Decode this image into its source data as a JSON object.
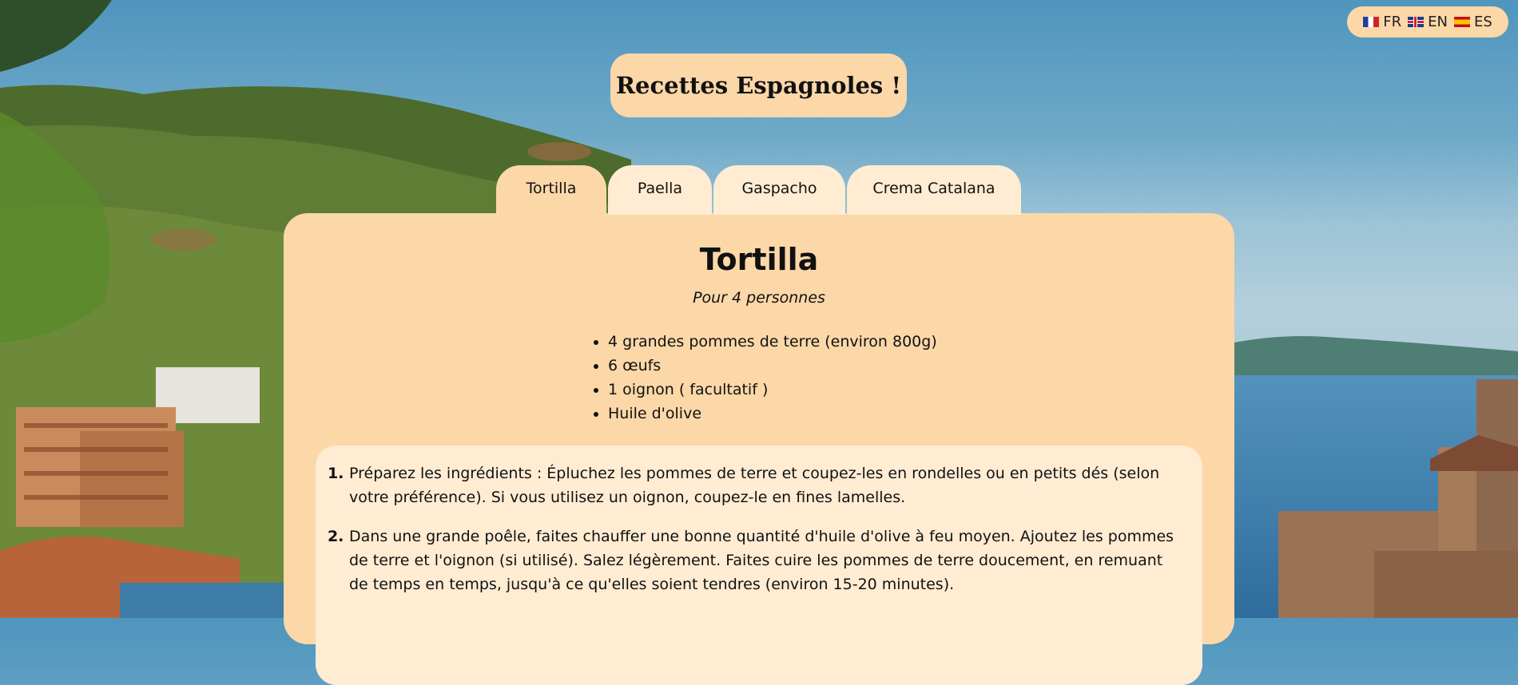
{
  "languages": [
    {
      "code": "FR",
      "flag_icon": "flag-fr-icon"
    },
    {
      "code": "EN",
      "flag_icon": "flag-uk-icon"
    },
    {
      "code": "ES",
      "flag_icon": "flag-es-icon"
    }
  ],
  "site": {
    "title": "Recettes Espagnoles !"
  },
  "tabs": [
    {
      "label": "Tortilla",
      "active": true
    },
    {
      "label": "Paella",
      "active": false
    },
    {
      "label": "Gaspacho",
      "active": false
    },
    {
      "label": "Crema Catalana",
      "active": false
    }
  ],
  "recipe": {
    "title": "Tortilla",
    "servings": "Pour 4 personnes",
    "ingredients": [
      "4 grandes pommes de terre (environ 800g)",
      "6 œufs",
      "1 oignon ( facultatif )",
      "Huile d'olive"
    ],
    "steps": [
      "Préparez les ingrédients : Épluchez les pommes de terre et coupez-les en rondelles ou en petits dés (selon votre préférence). Si vous utilisez un oignon, coupez-le en fines lamelles.",
      "Dans une grande poêle, faites chauffer une bonne quantité d'huile d'olive à feu moyen. Ajoutez les pommes de terre et l'oignon (si utilisé). Salez légèrement. Faites cuire les pommes de terre doucement, en remuant de temps en temps, jusqu'à ce qu'elles soient tendres (environ 15-20 minutes)."
    ]
  },
  "colors": {
    "panel": "#fcd7a8",
    "panel_light": "#ffecd3",
    "sky": "#4f95bd"
  }
}
